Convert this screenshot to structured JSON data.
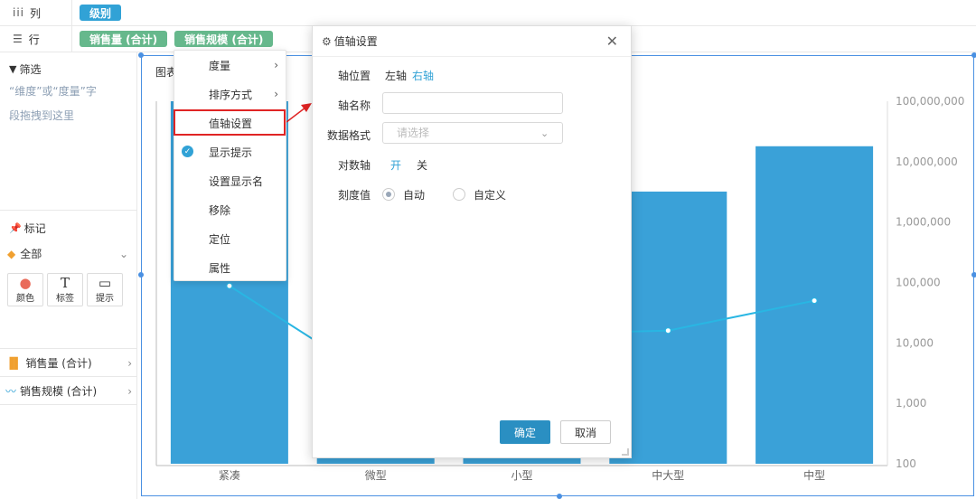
{
  "shelves": {
    "columns": {
      "label": "列",
      "icon": "columns-icon",
      "pills": [
        "级别"
      ]
    },
    "rows": {
      "label": "行",
      "icon": "rows-icon",
      "pills": [
        "销售量 (合计)",
        "销售规模 (合计)"
      ]
    }
  },
  "left_panel": {
    "filter_title": "筛选",
    "filter_hint_1": "“维度”或“度量”字",
    "filter_hint_2": "段拖拽到这里",
    "marks_title": "标记",
    "marks_type": "全部",
    "mark_buttons": [
      "颜色",
      "标签",
      "提示"
    ],
    "fields": [
      "销售量 (合计)",
      "销售规模 (合计)"
    ]
  },
  "chart": {
    "title_partial": "图表"
  },
  "context_menu": {
    "items": [
      "度量",
      "排序方式",
      "值轴设置",
      "显示提示",
      "设置显示名",
      "移除",
      "定位",
      "属性"
    ],
    "checked": "显示提示",
    "highlighted": "值轴设置"
  },
  "dialog": {
    "title": "值轴设置",
    "axis_position_label": "轴位置",
    "axis_left": "左轴",
    "axis_right": "右轴",
    "axis_name_label": "轴名称",
    "axis_name_value": "",
    "data_format_label": "数据格式",
    "data_format_placeholder": "请选择",
    "log_axis_label": "对数轴",
    "log_on": "开",
    "log_off": "关",
    "tick_label": "刻度值",
    "tick_auto": "自动",
    "tick_custom": "自定义",
    "ok": "确定",
    "cancel": "取消"
  },
  "colors": {
    "bar": "#3aa1d8",
    "line": "#29b6e3",
    "accent": "#31a2d6",
    "highlight": "#e02424"
  },
  "chart_data": {
    "type": "bar",
    "categories": [
      "紧凑",
      "微型",
      "小型",
      "中大型",
      "中型"
    ],
    "series": [
      {
        "values": [
          null,
          null,
          null,
          3200000,
          18000000
        ]
      },
      {
        "values": [
          88000,
          2500,
          14000,
          16000,
          50000
        ]
      }
    ],
    "right_axis": {
      "scale": "log",
      "ticks": [
        "100,000,000",
        "10,000,000",
        "1,000,000",
        "100,000",
        "10,000",
        "1,000",
        "100"
      ],
      "ylim": [
        100,
        100000000
      ]
    }
  }
}
